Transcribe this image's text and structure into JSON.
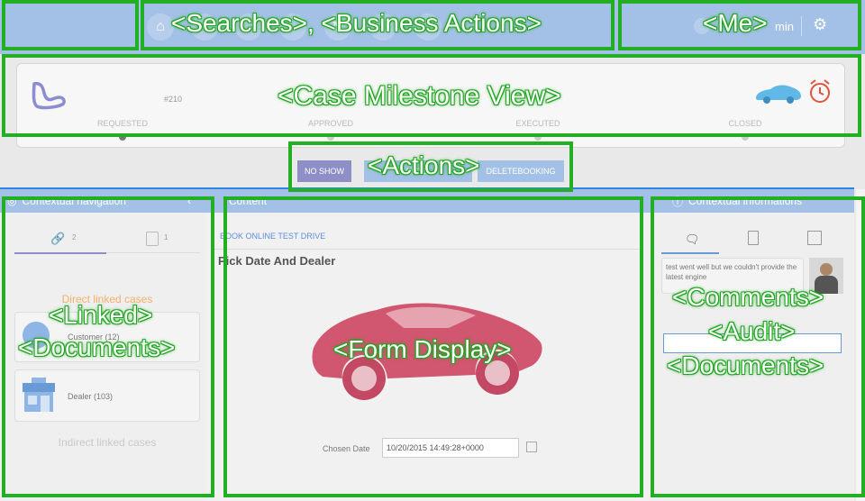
{
  "header": {
    "annotation_left": "<Searches>, <Business Actions>",
    "annotation_right": "<Me>",
    "user_text": "min"
  },
  "milestones": {
    "annotation": "<Case Milestone View>",
    "case_number": "#210",
    "stages": [
      "REQUESTED",
      "APPROVED",
      "EXECUTED",
      "CLOSED"
    ],
    "colors": {
      "active": "#777777",
      "inactive": "#cccccc"
    }
  },
  "actions": {
    "annotation": "<Actions>",
    "buttons": [
      "NO SHOW",
      "ANCEL",
      "DELETEBOOKING"
    ]
  },
  "left_panel": {
    "title": "Contextual navigation",
    "link_count": "2",
    "doc_count": "1",
    "direct_title": "Direct linked cases",
    "items": [
      "Customer (12)",
      "Dealer (103)"
    ],
    "indirect_title": "Indirect linked cases",
    "annotation_line1": "<Linked>",
    "annotation_line2": "<Documents>"
  },
  "main": {
    "title": "Content",
    "tab": "BOOK ONLINE TEST DRIVE",
    "form_title": "Pick Date And Dealer",
    "annotation": "<Form Display>",
    "date_label": "Chosen Date",
    "date_value": "10/20/2015 14:49:28+0000"
  },
  "right_panel": {
    "title": "Contextual informations",
    "comment_text": "test went well but we couldn't provide the latest engine",
    "annotation_line1": "<Comments>",
    "annotation_line2": "<Audit>",
    "annotation_line3": "<Documents>"
  },
  "colors": {
    "accent": "#2f84e6",
    "overlay": "#22b022",
    "car": "#d1566f",
    "alarm": "#e0533c"
  }
}
